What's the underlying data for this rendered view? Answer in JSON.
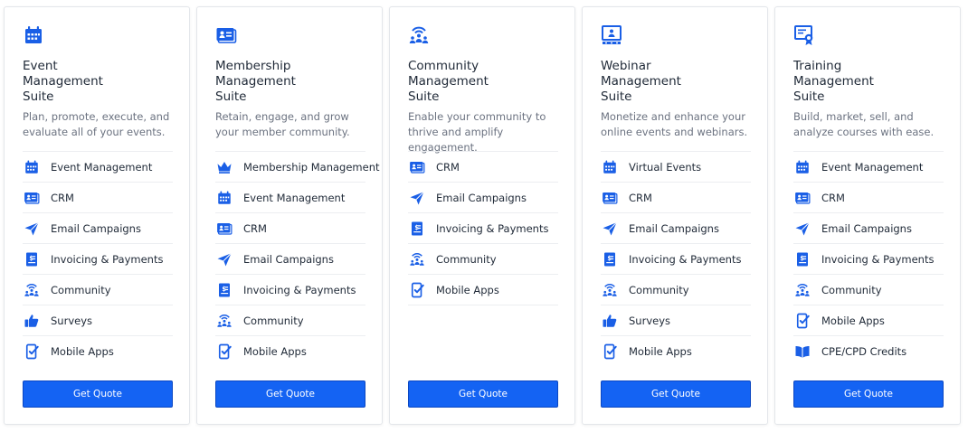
{
  "colors": {
    "accent": "#1463f3",
    "icon": "#1a5fe6",
    "text": "#1f2937",
    "muted": "#6b7280"
  },
  "cards": [
    {
      "icon": "calendar-icon",
      "title": [
        "Event",
        "Management",
        "Suite"
      ],
      "description": "Plan, promote, execute, and evaluate all of your events.",
      "features": [
        {
          "icon": "calendar-icon",
          "label": "Event Management"
        },
        {
          "icon": "id-card-icon",
          "label": "CRM"
        },
        {
          "icon": "paper-plane-icon",
          "label": "Email Campaigns"
        },
        {
          "icon": "invoice-icon",
          "label": "Invoicing & Payments"
        },
        {
          "icon": "community-icon",
          "label": "Community"
        },
        {
          "icon": "thumbs-up-icon",
          "label": "Surveys"
        },
        {
          "icon": "mobile-check-icon",
          "label": "Mobile Apps"
        }
      ],
      "button": "Get Quote"
    },
    {
      "icon": "id-card-icon",
      "title": [
        "Membership",
        "Management",
        "Suite"
      ],
      "description": "Retain, engage, and grow your member community.",
      "features": [
        {
          "icon": "crown-icon",
          "label": "Membership Management"
        },
        {
          "icon": "calendar-icon",
          "label": "Event Management"
        },
        {
          "icon": "id-card-icon",
          "label": "CRM"
        },
        {
          "icon": "paper-plane-icon",
          "label": "Email Campaigns"
        },
        {
          "icon": "invoice-icon",
          "label": "Invoicing & Payments"
        },
        {
          "icon": "community-icon",
          "label": "Community"
        },
        {
          "icon": "mobile-check-icon",
          "label": "Mobile Apps"
        }
      ],
      "button": "Get Quote"
    },
    {
      "icon": "community-icon",
      "title": [
        "Community",
        "Management",
        "Suite"
      ],
      "description": "Enable your community to thrive and amplify engagement.",
      "features": [
        {
          "icon": "id-card-icon",
          "label": "CRM"
        },
        {
          "icon": "paper-plane-icon",
          "label": "Email Campaigns"
        },
        {
          "icon": "invoice-icon",
          "label": "Invoicing & Payments"
        },
        {
          "icon": "community-icon",
          "label": "Community"
        },
        {
          "icon": "mobile-check-icon",
          "label": "Mobile Apps"
        }
      ],
      "button": "Get Quote"
    },
    {
      "icon": "webinar-icon",
      "title": [
        "Webinar",
        "Management",
        "Suite"
      ],
      "description": "Monetize and enhance your online events and webinars.",
      "features": [
        {
          "icon": "calendar-icon",
          "label": "Virtual Events"
        },
        {
          "icon": "id-card-icon",
          "label": "CRM"
        },
        {
          "icon": "paper-plane-icon",
          "label": "Email Campaigns"
        },
        {
          "icon": "invoice-icon",
          "label": "Invoicing & Payments"
        },
        {
          "icon": "community-icon",
          "label": "Community"
        },
        {
          "icon": "thumbs-up-icon",
          "label": "Surveys"
        },
        {
          "icon": "mobile-check-icon",
          "label": "Mobile Apps"
        }
      ],
      "button": "Get Quote"
    },
    {
      "icon": "certificate-icon",
      "title": [
        "Training",
        "Management",
        "Suite"
      ],
      "description": "Build, market, sell, and analyze courses with ease.",
      "features": [
        {
          "icon": "calendar-icon",
          "label": "Event Management"
        },
        {
          "icon": "id-card-icon",
          "label": "CRM"
        },
        {
          "icon": "paper-plane-icon",
          "label": "Email Campaigns"
        },
        {
          "icon": "invoice-icon",
          "label": "Invoicing & Payments"
        },
        {
          "icon": "community-icon",
          "label": "Community"
        },
        {
          "icon": "mobile-check-icon",
          "label": "Mobile Apps"
        },
        {
          "icon": "book-icon",
          "label": "CPE/CPD Credits"
        }
      ],
      "button": "Get Quote"
    }
  ]
}
